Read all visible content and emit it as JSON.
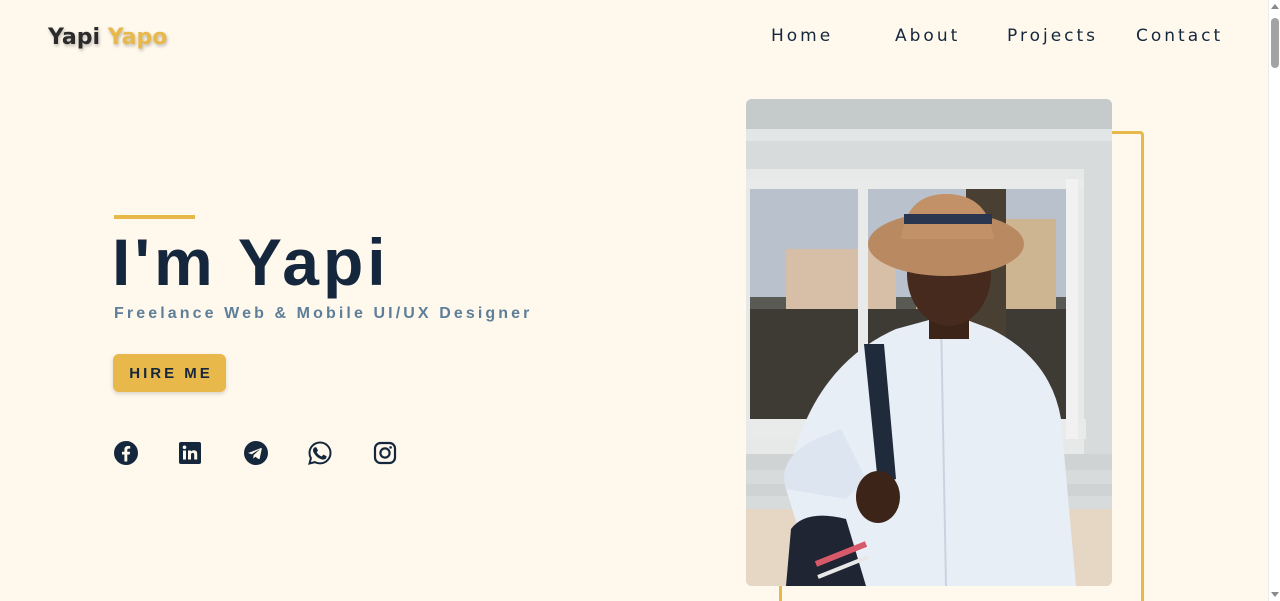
{
  "header": {
    "logo_first": "Yapi",
    "logo_second": "Yapo",
    "nav": [
      "Home",
      "About",
      "Projects",
      "Contact"
    ]
  },
  "hero": {
    "title": "I'm Yapi",
    "subtitle": "Freelance Web & Mobile UI/UX Designer",
    "cta_label": "HIRE ME"
  },
  "socials": [
    "facebook-icon",
    "linkedin-icon",
    "telegram-icon",
    "whatsapp-icon",
    "instagram-icon"
  ],
  "colors": {
    "background": "#fff8ec",
    "accent": "#e8b84a",
    "primary_text": "#14273d",
    "secondary_text": "#5e7e99"
  }
}
